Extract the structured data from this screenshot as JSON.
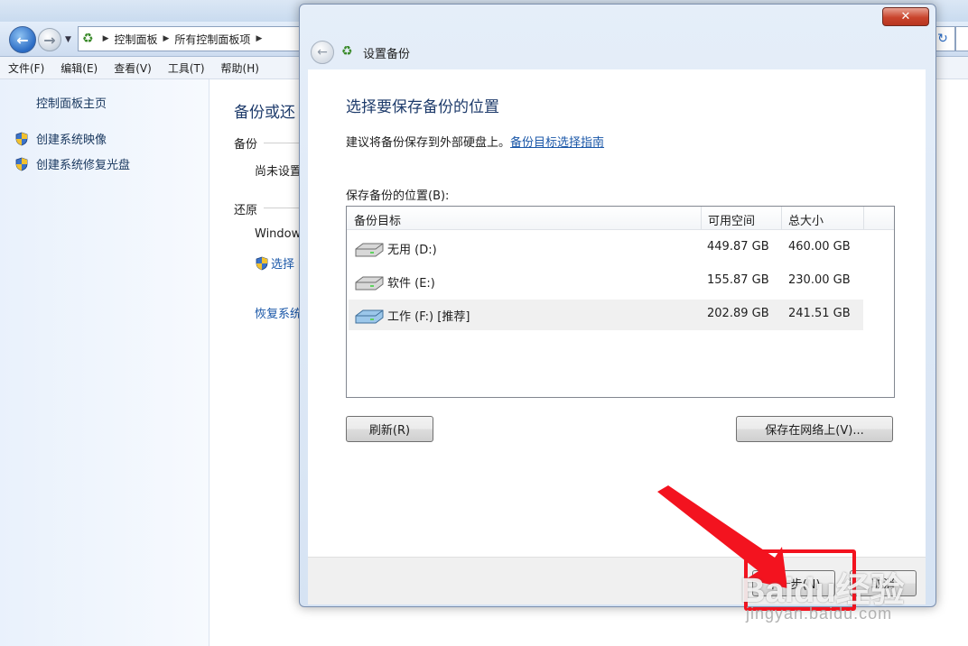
{
  "background": {
    "address": {
      "crumbs": [
        "控制面板",
        "所有控制面板项"
      ]
    },
    "menu": [
      "文件(F)",
      "编辑(E)",
      "查看(V)",
      "工具(T)",
      "帮助(H)"
    ],
    "left": {
      "home": "控制面板主页",
      "tasks": [
        "创建系统映像",
        "创建系统修复光盘"
      ]
    },
    "main": {
      "heading": "备份或还",
      "backup_label": "备份",
      "not_set": "尚未设置",
      "restore_label": "还原",
      "windows": "Window",
      "select_link": "选择",
      "recover_link": "恢复系统"
    }
  },
  "dialog": {
    "title": "设置备份",
    "close_glyph": "✕",
    "heading": "选择要保存备份的位置",
    "advice": "建议将备份保存到外部硬盘上。",
    "guide_link": "备份目标选择指南",
    "list_label": "保存备份的位置(B):",
    "columns": [
      "备份目标",
      "可用空间",
      "总大小"
    ],
    "rows": [
      {
        "name": "无用 (D:)",
        "free": "449.87 GB",
        "total": "460.00 GB"
      },
      {
        "name": "软件 (E:)",
        "free": "155.87 GB",
        "total": "230.00 GB"
      },
      {
        "name": "工作 (F:) [推荐]",
        "free": "202.89 GB",
        "total": "241.51 GB",
        "selected": true
      }
    ],
    "refresh_button": "刷新(R)",
    "network_button": "保存在网络上(V)...",
    "next_button": "下一步(N)",
    "cancel_button": "取消"
  },
  "overlay": {
    "watermark": "Baidu经验",
    "watermark_url": "jingyan.baidu.com",
    "arrow_color": "#f3131f"
  }
}
